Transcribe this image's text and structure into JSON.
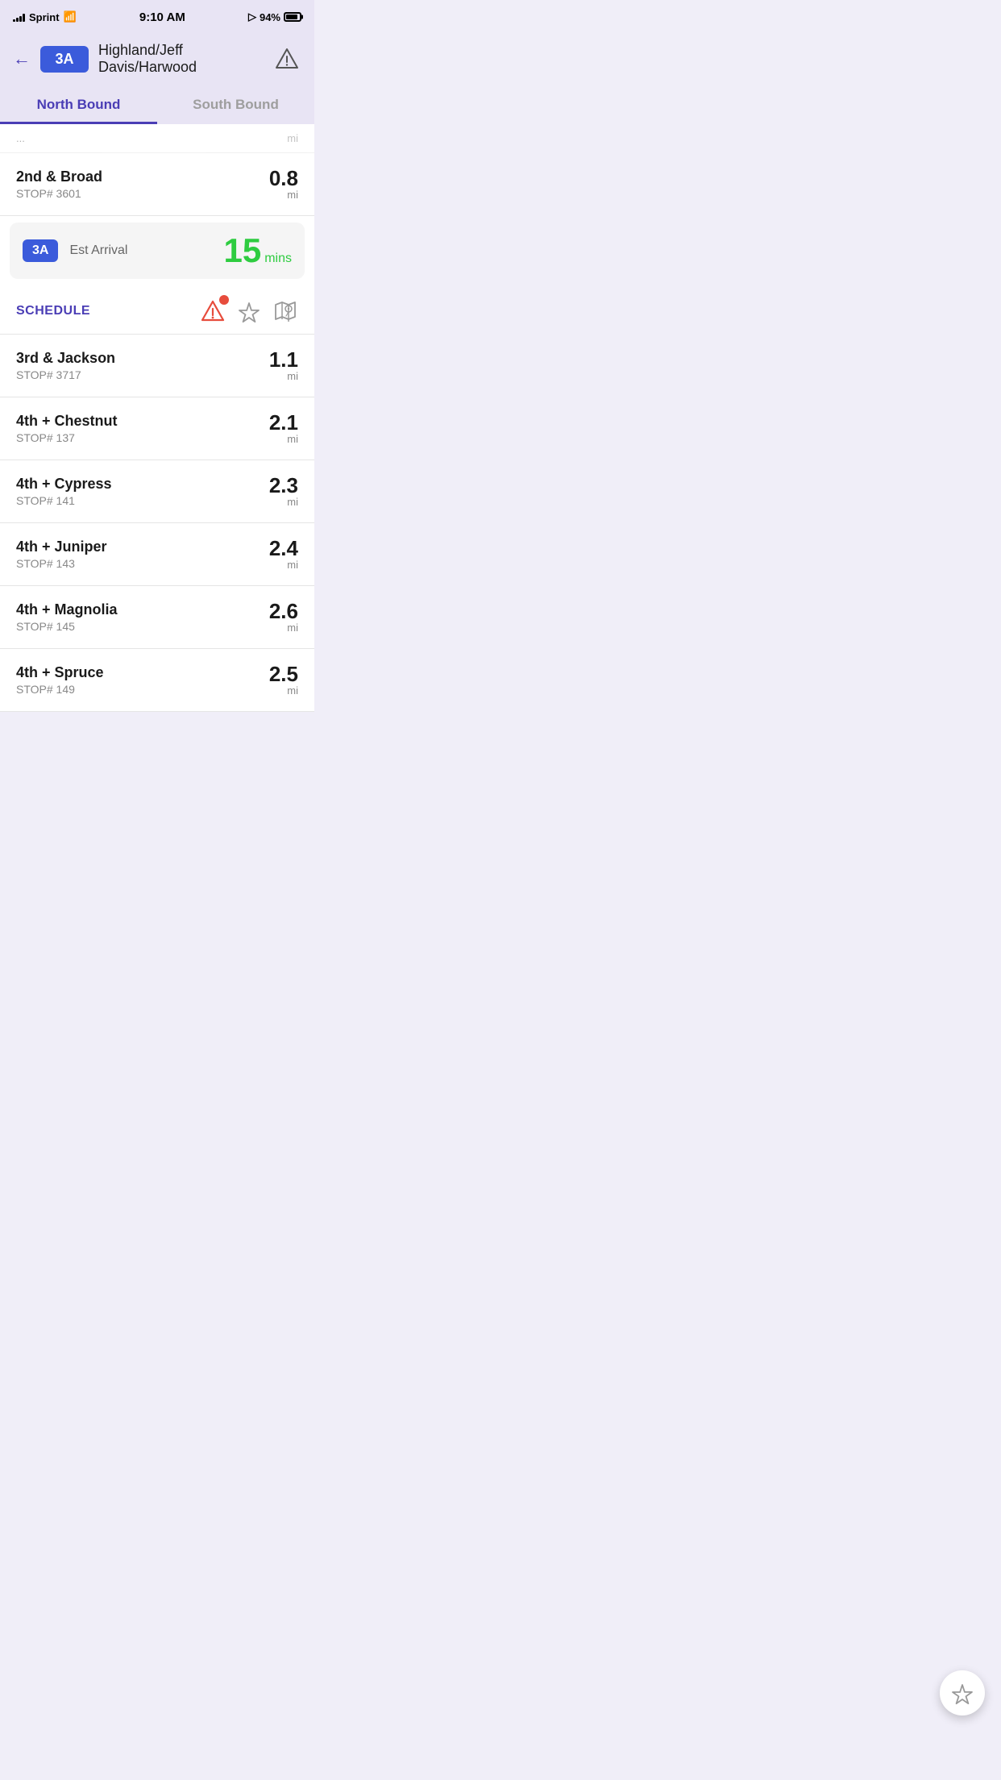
{
  "statusBar": {
    "carrier": "Sprint",
    "time": "9:10 AM",
    "battery": "94%"
  },
  "header": {
    "routeBadge": "3A",
    "routeTitle": "Highland/Jeff Davis/Harwood"
  },
  "tabs": {
    "northBound": "North Bound",
    "southBound": "South Bound",
    "activeTab": "northBound"
  },
  "partialStop": {
    "name": "...",
    "distance": "mi"
  },
  "firstStop": {
    "name": "2nd & Broad",
    "stopNumber": "STOP# 3601",
    "distance": "0.8",
    "unit": "mi"
  },
  "arrivalCard": {
    "badge": "3A",
    "label": "Est Arrival",
    "minutes": "15",
    "minutesLabel": "mins"
  },
  "scheduleSection": {
    "label": "SCHEDULE"
  },
  "stops": [
    {
      "name": "3rd & Jackson",
      "stopNumber": "STOP# 3717",
      "distance": "1.1",
      "unit": "mi"
    },
    {
      "name": "4th + Chestnut",
      "stopNumber": "STOP# 137",
      "distance": "2.1",
      "unit": "mi"
    },
    {
      "name": "4th + Cypress",
      "stopNumber": "STOP# 141",
      "distance": "2.3",
      "unit": "mi"
    },
    {
      "name": "4th + Juniper",
      "stopNumber": "STOP# 143",
      "distance": "2.4",
      "unit": "mi"
    },
    {
      "name": "4th + Magnolia",
      "stopNumber": "STOP# 145",
      "distance": "2.6",
      "unit": "mi"
    },
    {
      "name": "4th + Spruce",
      "stopNumber": "STOP# 149",
      "distance": "2.5",
      "unit": "mi"
    }
  ]
}
